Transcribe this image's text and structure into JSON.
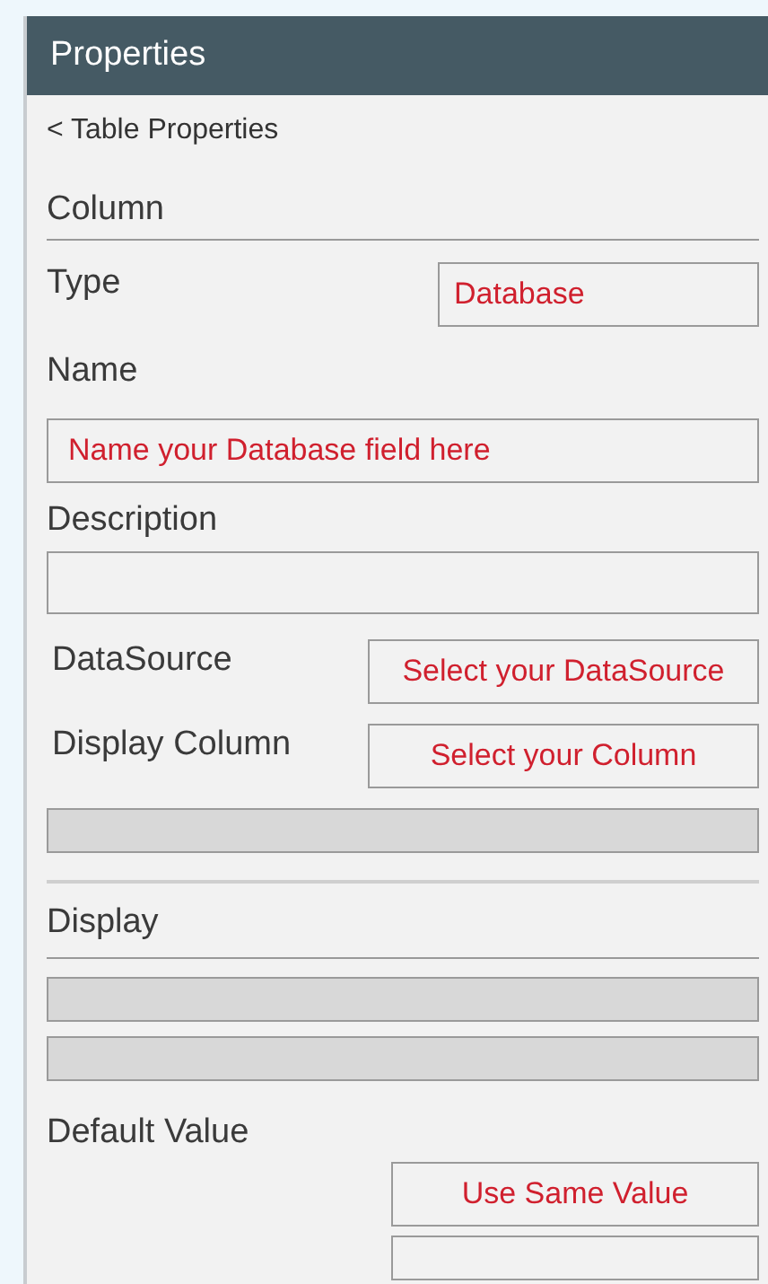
{
  "panel": {
    "title": "Properties"
  },
  "back_link": "< Table Properties",
  "section": "Column",
  "type": {
    "label": "Type",
    "value": "Database"
  },
  "name": {
    "label": "Name",
    "placeholder": "Name your Database field here"
  },
  "description": {
    "label": "Description"
  },
  "datasource": {
    "label": "DataSource",
    "placeholder": "Select your DataSource"
  },
  "display_column": {
    "label": "Display Column",
    "placeholder": "Select your Column",
    "extra_field": {
      "disabled": true
    }
  },
  "display": {
    "label": "Display",
    "fields": [
      {
        "disabled": true
      },
      {
        "disabled": true
      }
    ]
  },
  "default_value": {
    "label": "Default Value",
    "button": "Use Same Value",
    "field": {
      "disabled": false
    }
  }
}
